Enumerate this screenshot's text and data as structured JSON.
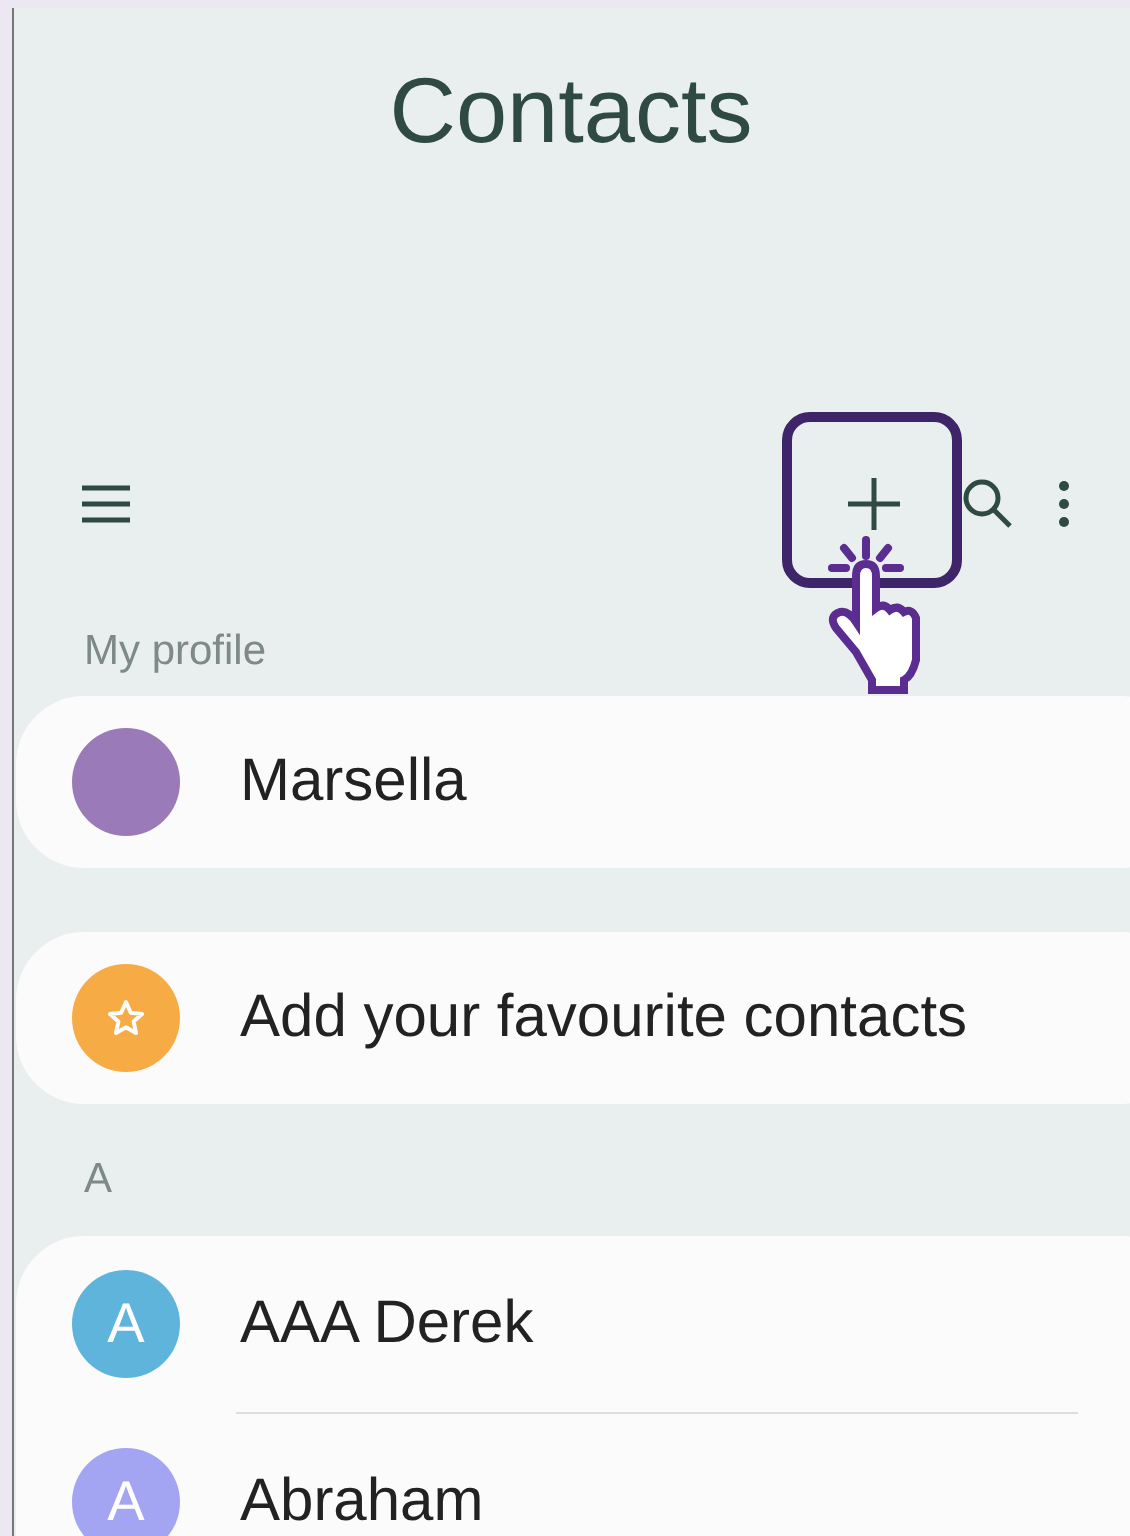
{
  "title": "Contacts",
  "toolbar": {
    "add_highlighted": true
  },
  "profile": {
    "heading": "My profile",
    "name": "Marsella",
    "color": "#9a7ab8"
  },
  "favourites": {
    "label": "Add your favourite contacts",
    "color": "#f7ab45"
  },
  "section": {
    "letter": "A",
    "contacts": [
      {
        "initial": "A",
        "name": "AAA Derek",
        "color": "#5fb4dc"
      },
      {
        "initial": "A",
        "name": "Abraham",
        "color": "#a3a5f2"
      }
    ]
  }
}
